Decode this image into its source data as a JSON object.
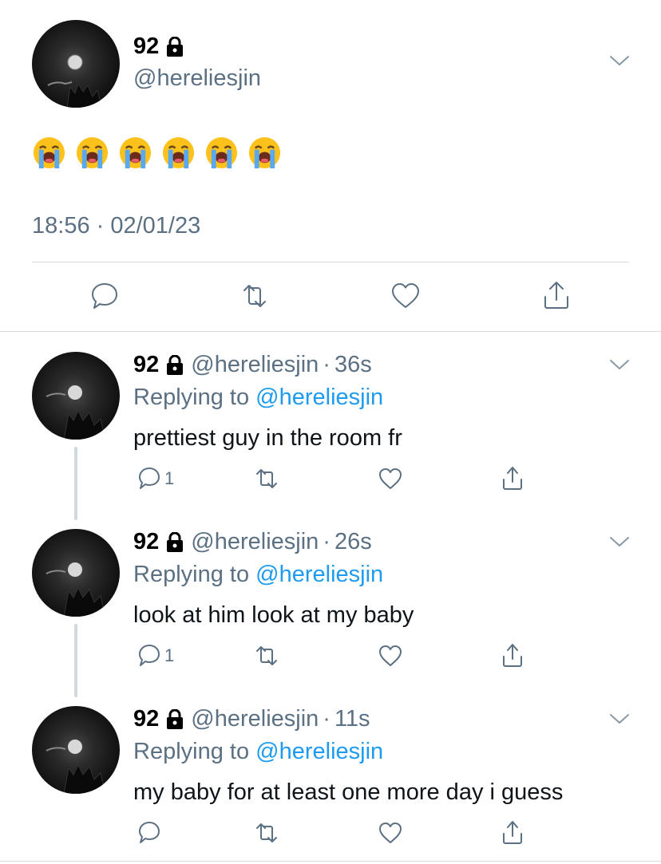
{
  "main_tweet": {
    "display_name": "92",
    "handle": "@hereliesjin",
    "emojis": [
      "loudly-crying-face",
      "loudly-crying-face",
      "loudly-crying-face",
      "loudly-crying-face",
      "loudly-crying-face",
      "loudly-crying-face"
    ],
    "timestamp": "18:56 · 02/01/23"
  },
  "replies": [
    {
      "display_name": "92",
      "handle": "@hereliesjin",
      "separator": "·",
      "time": "36s",
      "replying_prefix": "Replying to",
      "replying_to": "@hereliesjin",
      "text": "prettiest guy in the room fr",
      "reply_count": "1"
    },
    {
      "display_name": "92",
      "handle": "@hereliesjin",
      "separator": "·",
      "time": "26s",
      "replying_prefix": "Replying to",
      "replying_to": "@hereliesjin",
      "text": "look at him look at my baby",
      "reply_count": "1"
    },
    {
      "display_name": "92",
      "handle": "@hereliesjin",
      "separator": "·",
      "time": "11s",
      "replying_prefix": "Replying to",
      "replying_to": "@hereliesjin",
      "text": "my baby for at least one more day i guess",
      "reply_count": ""
    }
  ],
  "icons": {
    "lock": "lock-icon",
    "chevron": "chevron-down-icon",
    "reply": "reply-icon",
    "retweet": "retweet-icon",
    "like": "heart-icon",
    "share": "share-icon"
  },
  "colors": {
    "link": "#1d9bf0",
    "secondary_text": "#5b7083",
    "thread_line": "#cfd9de"
  }
}
